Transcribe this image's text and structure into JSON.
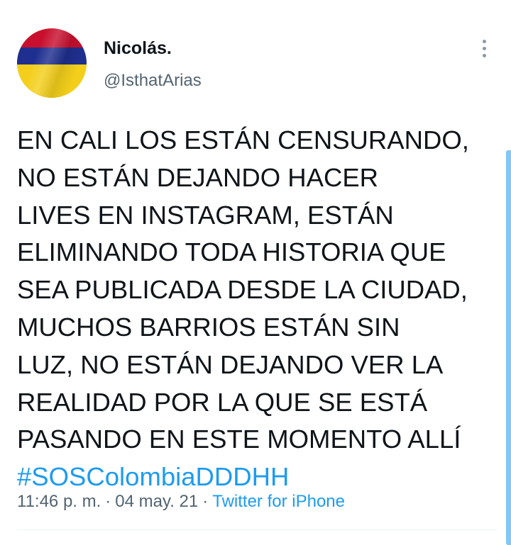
{
  "tweet": {
    "author": {
      "display_name": "Nicolás.",
      "handle": "@IsthatArias",
      "avatar_icon": "colombia-flag-avatar",
      "avatar_colors": [
        "#c8102e",
        "#1f2f8f",
        "#f3cf1b"
      ]
    },
    "menu_icon": "more-vertical-icon",
    "text_lines": [
      "EN CALI LOS ESTÁN CENSURANDO,",
      "NO ESTÁN DEJANDO HACER",
      "LIVES EN INSTAGRAM, ESTÁN",
      "ELIMINANDO TODA HISTORIA QUE",
      "SEA PUBLICADA DESDE LA CIUDAD,",
      "MUCHOS BARRIOS ESTÁN SIN",
      "LUZ, NO ESTÁN DEJANDO VER LA",
      "REALIDAD POR LA QUE SE ESTÁ",
      "PASANDO EN ESTE MOMENTO ALLÍ"
    ],
    "hashtag": "#SOSColombiaDDDHH",
    "time": "11:46 p. m.",
    "separator": "·",
    "date": "04 may. 21",
    "source": "Twitter for iPhone"
  },
  "colors": {
    "accent": "#1d9bf0",
    "text": "#0f1419",
    "secondary": "#536471"
  }
}
